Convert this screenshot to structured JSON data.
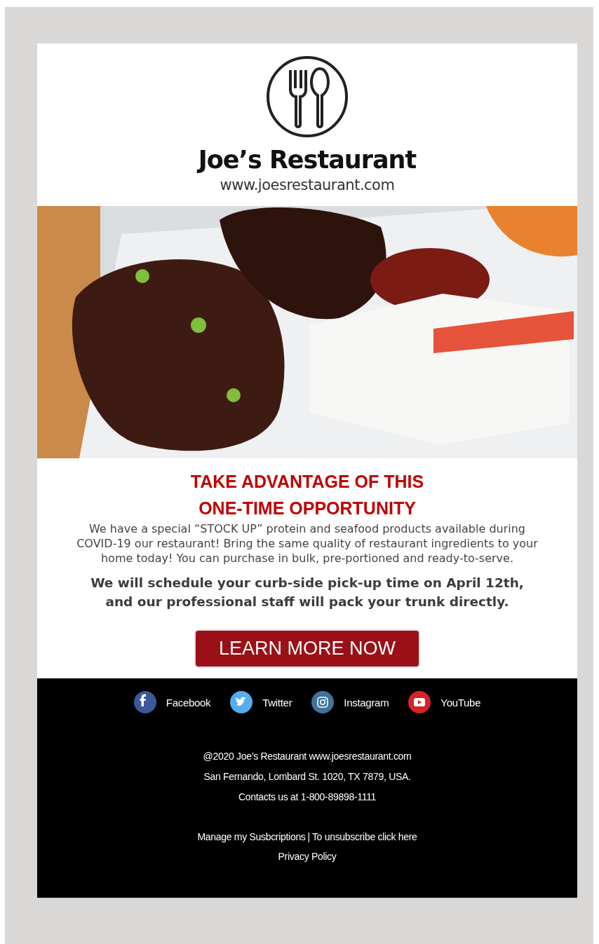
{
  "header": {
    "name": "Joe’s Restaurant",
    "website": "www.joesrestaurant.com"
  },
  "promo": {
    "heading": [
      "TAKE ADVANTAGE OF THIS",
      "ONE-TIME OPPORTUNITY"
    ],
    "body": "We have a special “STOCK UP” protein and seafood products available during COVID-19 our restaurant!  Bring the same quality of restaurant ingredients to your home today! You can purchase in bulk, pre-portioned and ready-to-serve.",
    "highlight": "We will schedule your curb-side pick-up time on April 12th, and our professional staff will pack your trunk directly.",
    "button": "LEARN MORE NOW"
  },
  "footer": {
    "social": [
      {
        "kind": "facebook",
        "label": "Facebook",
        "color": "#3b5998"
      },
      {
        "kind": "twitter",
        "label": "Twitter",
        "color": "#55acee"
      },
      {
        "kind": "instagram",
        "label": "Instagram",
        "color": "#3f729b"
      },
      {
        "kind": "youtube",
        "label": "YouTube",
        "color": "#d42428"
      }
    ],
    "lines": [
      "@2020 Joe’s Restaurant  www.joesrestaurant.com",
      "San Fernando,  Lombard St. 1020, TX 7879, USA.",
      "Contacts us at 1-800-89898-1111"
    ],
    "links": [
      "Manage my Susbcriptions",
      "To unsubscribe click here"
    ],
    "separator": "|",
    "privacy": "Privacy Policy"
  }
}
